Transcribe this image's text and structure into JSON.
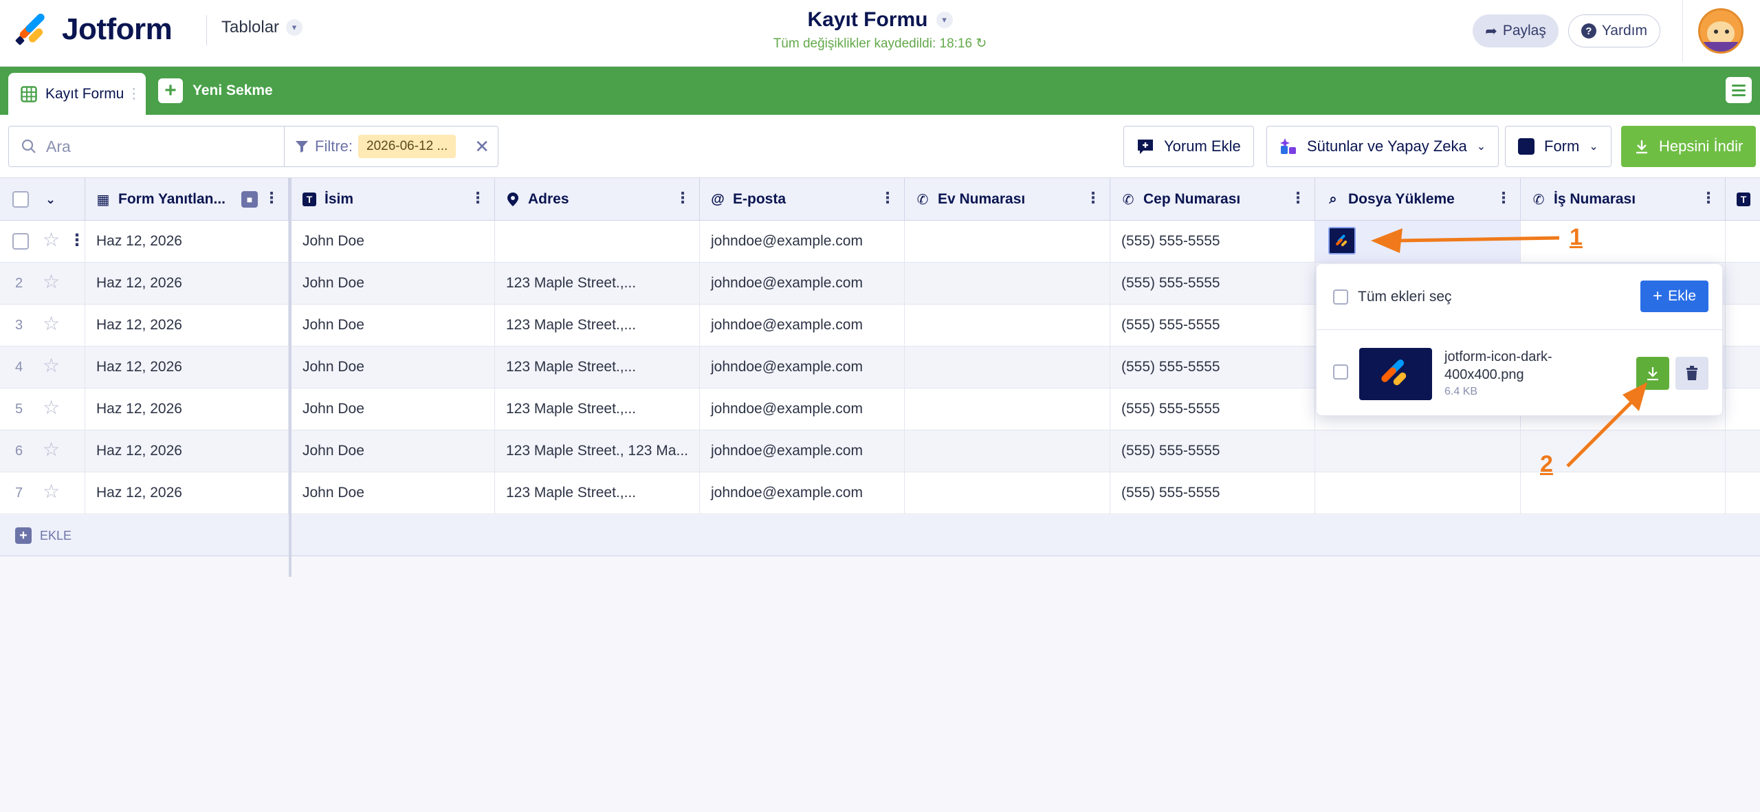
{
  "header": {
    "brand": "Jotform",
    "tables_menu": "Tablolar",
    "form_title": "Kayıt Formu",
    "save_status": "Tüm değişiklikler kaydedildi: 18:16",
    "share_label": "Paylaş",
    "help_label": "Yardım"
  },
  "tabs": {
    "active": "Kayıt Formu",
    "new_tab": "Yeni Sekme"
  },
  "toolbar": {
    "search_placeholder": "Ara",
    "filter_label": "Filtre",
    "filter_colon": ":",
    "filter_value": "2026-06-12 ...",
    "comment_btn": "Yorum Ekle",
    "columns_ai_btn": "Sütunlar ve Yapay Zeka",
    "form_btn": "Form",
    "download_all_btn": "Hepsini İndir"
  },
  "table": {
    "columns": [
      "Form Yanıtlan...",
      "İsim",
      "Adres",
      "E-posta",
      "Ev Numarası",
      "Cep Numarası",
      "Dosya Yükleme",
      "İş Numarası"
    ],
    "rows": [
      {
        "num": "",
        "date": "Haz 12, 2026",
        "name": "John Doe",
        "address": "",
        "email": "johndoe@example.com",
        "home": "",
        "cell": "(555) 555-5555",
        "work": ""
      },
      {
        "num": "2",
        "date": "Haz 12, 2026",
        "name": "John Doe",
        "address": "123 Maple Street.,...",
        "email": "johndoe@example.com",
        "home": "",
        "cell": "(555) 555-5555",
        "work": ""
      },
      {
        "num": "3",
        "date": "Haz 12, 2026",
        "name": "John Doe",
        "address": "123 Maple Street.,...",
        "email": "johndoe@example.com",
        "home": "",
        "cell": "(555) 555-5555",
        "work": ""
      },
      {
        "num": "4",
        "date": "Haz 12, 2026",
        "name": "John Doe",
        "address": "123 Maple Street.,...",
        "email": "johndoe@example.com",
        "home": "",
        "cell": "(555) 555-5555",
        "work": ""
      },
      {
        "num": "5",
        "date": "Haz 12, 2026",
        "name": "John Doe",
        "address": "123 Maple Street.,...",
        "email": "johndoe@example.com",
        "home": "",
        "cell": "(555) 555-5555",
        "work": ""
      },
      {
        "num": "6",
        "date": "Haz 12, 2026",
        "name": "John Doe",
        "address": "123 Maple Street., 123 Ma...",
        "email": "johndoe@example.com",
        "home": "",
        "cell": "(555) 555-5555",
        "work": ""
      },
      {
        "num": "7",
        "date": "Haz 12, 2026",
        "name": "John Doe",
        "address": "123 Maple Street.,...",
        "email": "johndoe@example.com",
        "home": "",
        "cell": "(555) 555-5555",
        "work": ""
      }
    ],
    "add_row_label": "EKLE"
  },
  "popover": {
    "select_all": "Tüm ekleri seç",
    "add_label": "Ekle",
    "file_name": "jotform-icon-dark-400x400.png",
    "file_size": "6.4 KB"
  },
  "annotations": {
    "step1": "1",
    "step2": "2"
  },
  "colors": {
    "brand_green": "#4aa14a",
    "download_green": "#6fbe44",
    "annotation_orange": "#f07a1b",
    "navy": "#0a1551",
    "add_blue": "#2a6ee6"
  }
}
